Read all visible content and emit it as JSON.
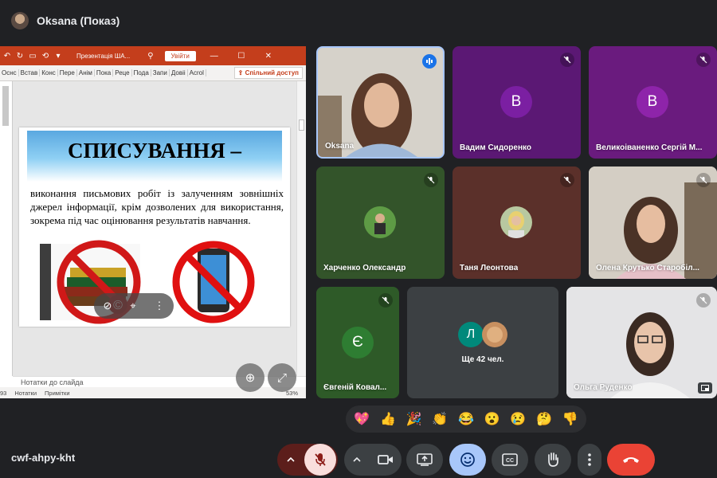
{
  "header": {
    "presenter_title": "Oksana (Показ)"
  },
  "presentation": {
    "app_title": "Презентація ША...",
    "signin_label": "Увійти",
    "ribbon_tabs": [
      "Оснс",
      "Встав",
      "Конс",
      "Пере",
      "Анім",
      "Пока",
      "Реце",
      "Пода",
      "Запи",
      "Довіі",
      "Acrol"
    ],
    "share_label": "Спільний доступ",
    "slide_title": "СПИСУВАННЯ –",
    "slide_body": "виконання письмових робіт із залученням зовнішніх джерел інформації, крім дозволених для використання, зокрема під час оцінювання результатів навчання.",
    "notes_label": "Нотатки до слайда",
    "status_left": "93",
    "status_notes": "Нотатки",
    "status_comments": "Примітки",
    "zoom_value": "53%"
  },
  "participants": [
    {
      "name": "Oksana",
      "speaking": true
    },
    {
      "name": "Вадим Сидоренко",
      "initial": "В",
      "color": "#7b1fa2",
      "bg": "#5b1874"
    },
    {
      "name": "Великоіваненко Сергій М...",
      "initial": "В",
      "color": "#8e24aa",
      "bg": "#6a1b7e"
    },
    {
      "name": "Харченко Олександр",
      "bg": "#33542a"
    },
    {
      "name": "Таня Леонтова",
      "bg": "#5b302a"
    },
    {
      "name": "Олена Крутько Старобіл..."
    },
    {
      "name": "Євгеній Ковал...",
      "initial": "Є",
      "color": "#2e7d32",
      "bg": "#2e5a28"
    },
    {
      "more_label": "Ще 42 чел.",
      "initial": "Л"
    },
    {
      "name": "Ольга Руденко"
    }
  ],
  "reactions": [
    "💖",
    "👍",
    "🎉",
    "👏",
    "😂",
    "😮",
    "😢",
    "🤔",
    "👎"
  ],
  "footer": {
    "meeting_code": "cwf-ahpy-kht"
  },
  "colors": {
    "end_call": "#ea4335",
    "mic_off_bg": "#f9dedc",
    "emoji_active": "#a8c7fa"
  }
}
